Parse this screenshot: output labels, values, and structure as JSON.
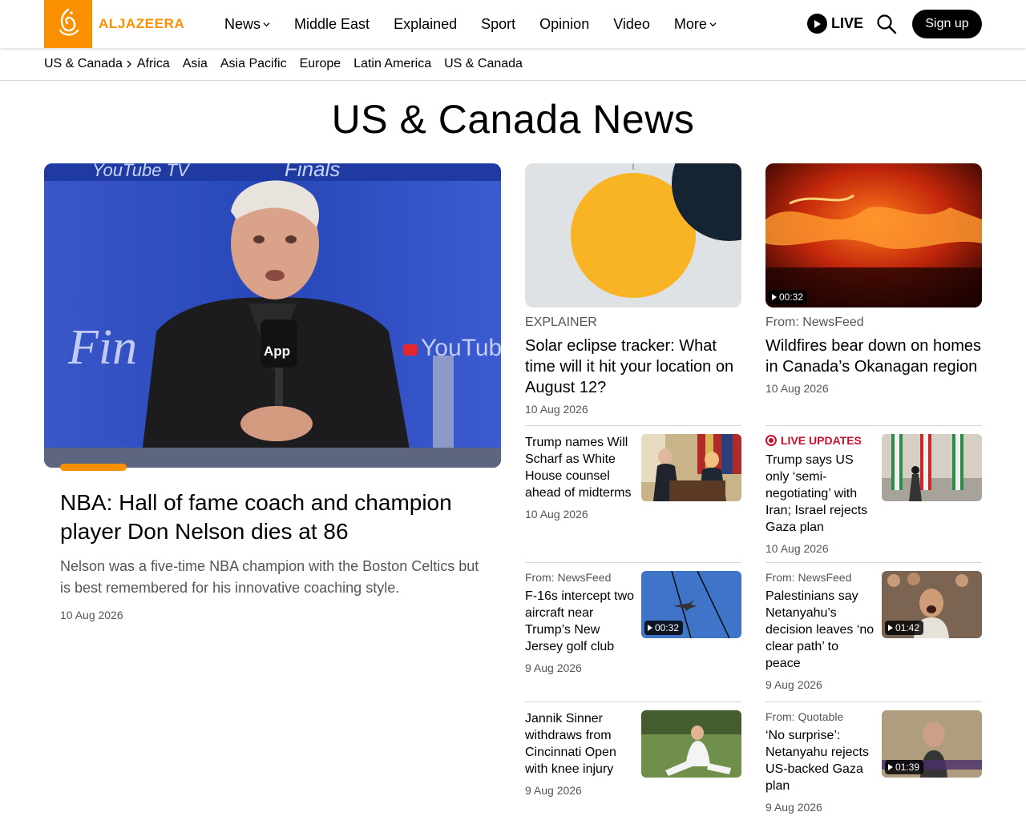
{
  "header": {
    "logo_text": "ALJAZEERA",
    "nav": [
      {
        "label": "News",
        "dropdown": true
      },
      {
        "label": "Middle East",
        "dropdown": false
      },
      {
        "label": "Explained",
        "dropdown": false
      },
      {
        "label": "Sport",
        "dropdown": false
      },
      {
        "label": "Opinion",
        "dropdown": false
      },
      {
        "label": "Video",
        "dropdown": false
      },
      {
        "label": "More",
        "dropdown": true
      }
    ],
    "live_label": "LIVE",
    "signup_label": "Sign up"
  },
  "subnav": {
    "parent": "US & Canada",
    "items": [
      "Africa",
      "Asia",
      "Asia Pacific",
      "Europe",
      "Latin America",
      "US & Canada"
    ]
  },
  "page_title": "US & Canada News",
  "hero": {
    "title": "NBA: Hall of fame coach and champion player Don Nelson dies at 86",
    "summary": "Nelson was a five-time NBA champion with the Boston Celtics but is best remembered for his innovative coaching style.",
    "date": "10 Aug 2026"
  },
  "col2_big": {
    "kicker": "EXPLAINER",
    "title": "Solar eclipse tracker: What time will it hit your location on August 12?",
    "date": "10 Aug 2026"
  },
  "col3_big": {
    "kicker": "From: NewsFeed",
    "title": "Wildfires bear down on homes in Canada’s Okanagan region",
    "date": "10 Aug 2026",
    "duration": "00:32"
  },
  "col2_small": [
    {
      "kicker": "",
      "title": "Trump names Will Scharf as White House counsel ahead of midterms",
      "date": "10 Aug 2026",
      "duration": ""
    },
    {
      "kicker": "From: NewsFeed",
      "title": "F-16s intercept two aircraft near Trump’s New Jersey golf club",
      "date": "9 Aug 2026",
      "duration": "00:32"
    },
    {
      "kicker": "",
      "title": "Jannik Sinner withdraws from Cincinnati Open with knee injury",
      "date": "9 Aug 2026",
      "duration": ""
    }
  ],
  "col3_small": [
    {
      "kicker": "LIVE UPDATES",
      "title": "Trump says US only ‘semi-negotiating’ with Iran; Israel rejects Gaza plan",
      "date": "10 Aug 2026",
      "duration": ""
    },
    {
      "kicker": "From: NewsFeed",
      "title": "Palestinians say Netanyahu’s decision leaves ‘no clear path’ to peace",
      "date": "9 Aug 2026",
      "duration": "01:42"
    },
    {
      "kicker": "From: Quotable",
      "title": "‘No surprise’: Netanyahu rejects US-backed Gaza plan",
      "date": "9 Aug 2026",
      "duration": "01:39"
    }
  ],
  "colors": {
    "brand": "#fa9000",
    "live": "#c8102e"
  }
}
